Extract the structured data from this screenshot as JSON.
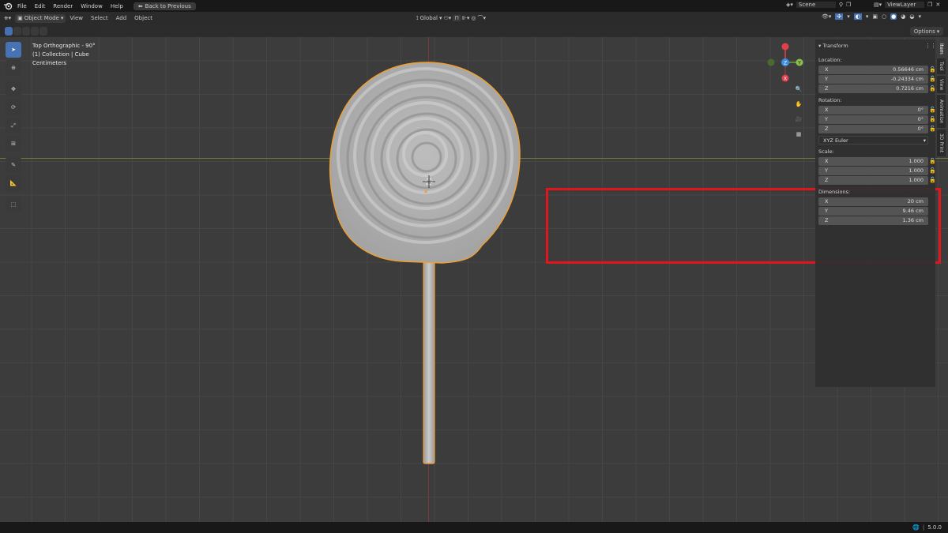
{
  "menubar": {
    "items": [
      "File",
      "Edit",
      "Render",
      "Window",
      "Help"
    ],
    "back_button": "Back to Previous",
    "scene": "Scene",
    "view_layer": "ViewLayer"
  },
  "header": {
    "mode": "Object Mode",
    "menus": [
      "View",
      "Select",
      "Add",
      "Object"
    ],
    "transform_orientation": "Global",
    "options": "Options"
  },
  "viewport": {
    "view_name": "Top Orthographic - 90°",
    "collection": "(1) Collection | Cube",
    "units": "Centimeters",
    "gizmo": {
      "x": "X",
      "y": "Y",
      "z": "Z"
    }
  },
  "npanel": {
    "transform_title": "Transform",
    "location_label": "Location:",
    "location": [
      {
        "axis": "X",
        "value": "0.56646 cm"
      },
      {
        "axis": "Y",
        "value": "-0.24334 cm"
      },
      {
        "axis": "Z",
        "value": "0.7216 cm"
      }
    ],
    "rotation_label": "Rotation:",
    "rotation": [
      {
        "axis": "X",
        "value": "0°"
      },
      {
        "axis": "Y",
        "value": "0°"
      },
      {
        "axis": "Z",
        "value": "0°"
      }
    ],
    "rotation_mode": "XYZ Euler",
    "scale_label": "Scale:",
    "scale": [
      {
        "axis": "X",
        "value": "1.000"
      },
      {
        "axis": "Y",
        "value": "1.000"
      },
      {
        "axis": "Z",
        "value": "1.000"
      }
    ],
    "dimensions_label": "Dimensions:",
    "dimensions": [
      {
        "axis": "X",
        "value": "20 cm"
      },
      {
        "axis": "Y",
        "value": "9.46 cm"
      },
      {
        "axis": "Z",
        "value": "1.36 cm"
      }
    ],
    "tabs": [
      "Item",
      "Tool",
      "View",
      "Animation",
      "3D Print"
    ]
  },
  "status": {
    "version": "5.0.0"
  },
  "colors": {
    "highlight_box": "#e1161c",
    "selection_outline": "#f0a030",
    "active_tool": "#4772b3",
    "axis_x": "#e0404a",
    "axis_y": "#6aa33a",
    "axis_z": "#3d8ee8"
  }
}
